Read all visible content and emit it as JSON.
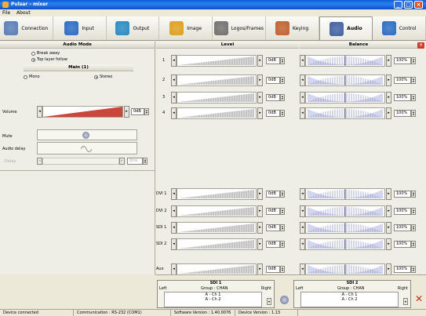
{
  "window": {
    "title": "Pulsar - mixer"
  },
  "menu": [
    "File",
    "About"
  ],
  "tabs": [
    {
      "label": "Connection",
      "icon": "plug-icon",
      "color": "#5a7db8"
    },
    {
      "label": "Input",
      "icon": "input-icon",
      "color": "#2a6cc4"
    },
    {
      "label": "Output",
      "icon": "output-icon",
      "color": "#2a8ac4"
    },
    {
      "label": "Image",
      "icon": "image-icon",
      "color": "#e0a020"
    },
    {
      "label": "Logos/Frames",
      "icon": "logo-icon",
      "color": "#707070"
    },
    {
      "label": "Keying",
      "icon": "keying-icon",
      "color": "#c06030"
    },
    {
      "label": "Audio",
      "icon": "audio-icon",
      "color": "#4060a0",
      "active": true
    },
    {
      "label": "Control",
      "icon": "control-icon",
      "color": "#2a6cc4"
    }
  ],
  "left": {
    "audio_mode": {
      "title": "Audio Mode",
      "opt1": "Break away",
      "opt2": "Top layer follow"
    },
    "main": {
      "title": "Main (1)",
      "opt1": "Mono",
      "opt2": "Stereo"
    },
    "volume_label": "Volume",
    "volume_value": "0dB",
    "mute_label": "Mute",
    "audio_delay_label": "Audio delay",
    "delay_label": "Delay",
    "delay_value": "0ms"
  },
  "right": {
    "level_title": "Level",
    "balance_title": "Balance",
    "rows": [
      {
        "label": "1",
        "level": "0dB",
        "balance": "100%"
      },
      {
        "label": "2",
        "level": "0dB",
        "balance": "100%"
      },
      {
        "label": "3",
        "level": "0dB",
        "balance": "100%"
      },
      {
        "label": "4",
        "level": "0dB",
        "balance": "100%"
      },
      {
        "label": "DVI 1",
        "level": "0dB",
        "balance": "100%"
      },
      {
        "label": "DVI 2",
        "level": "0dB",
        "balance": "100%"
      },
      {
        "label": "SDI 1",
        "level": "0dB",
        "balance": "100%"
      },
      {
        "label": "SDI 2",
        "level": "0dB",
        "balance": "100%"
      },
      {
        "label": "Aux",
        "level": "0dB",
        "balance": "100%"
      }
    ]
  },
  "sdi": [
    {
      "title": "SDI 1",
      "left": "Left",
      "right": "Right",
      "group": "Group : CHAN",
      "ch1": "A - Ch 1",
      "ch2": "A - Ch 2"
    },
    {
      "title": "SDI 2",
      "left": "Left",
      "right": "Right",
      "group": "Group : CHAN",
      "ch1": "A - Ch 1",
      "ch2": "A - Ch 2"
    }
  ],
  "status": [
    "Device connected",
    "Communication : RS-232 (COM1)",
    "Software Version : 1.40.0076",
    "Device Version : 1.13"
  ]
}
